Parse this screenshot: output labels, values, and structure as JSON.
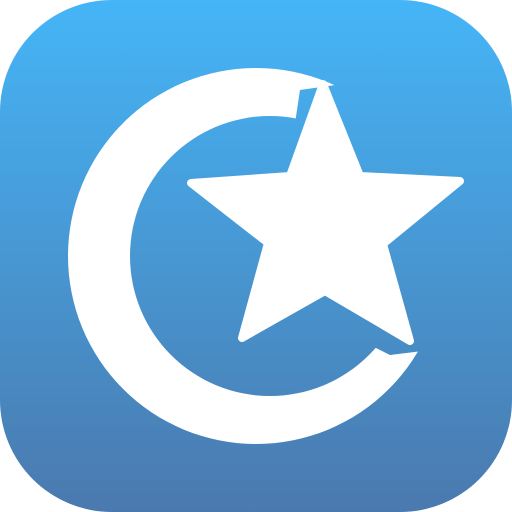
{
  "app_icon": {
    "icon_name": "crescent-star-icon",
    "colors": {
      "gradient_top": "#45B5F7",
      "gradient_bottom": "#4A79AE",
      "symbol": "#FFFFFF"
    }
  }
}
